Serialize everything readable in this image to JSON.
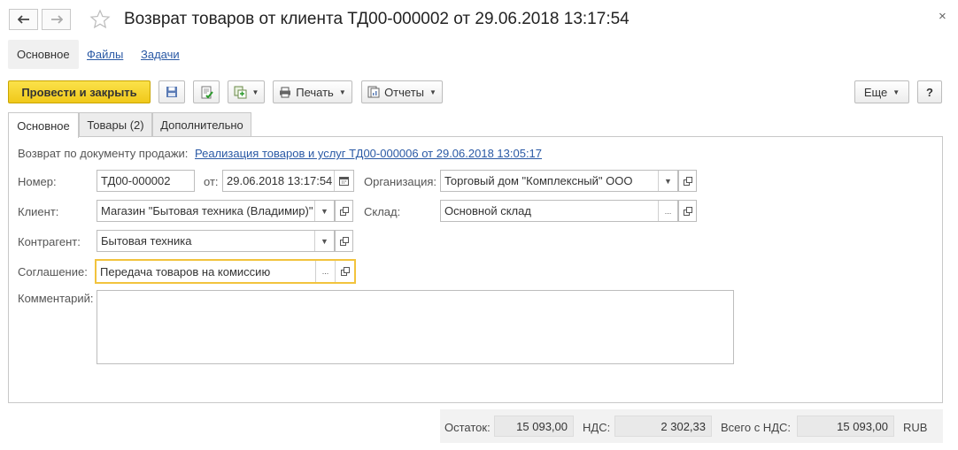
{
  "window": {
    "title": "Возврат товаров от клиента ТД00-000002 от 29.06.2018 13:17:54",
    "close_glyph": "×"
  },
  "sections": [
    "Основное",
    "Файлы",
    "Задачи"
  ],
  "toolbar": {
    "post_and_close": "Провести и закрыть",
    "print": "Печать",
    "reports": "Отчеты",
    "more": "Еще",
    "help": "?"
  },
  "tabs": [
    "Основное",
    "Товары (2)",
    "Дополнительно"
  ],
  "form": {
    "base_doc_label": "Возврат по документу продажи:",
    "base_doc_link": "Реализация товаров и услуг ТД00-000006 от 29.06.2018 13:05:17",
    "number_label": "Номер:",
    "number_value": "ТД00-000002",
    "date_label": "от:",
    "date_value": "29.06.2018 13:17:54",
    "org_label": "Организация:",
    "org_value": "Торговый дом \"Комплексный\" ООО",
    "client_label": "Клиент:",
    "client_value": "Магазин \"Бытовая техника (Владимир)\"",
    "warehouse_label": "Склад:",
    "warehouse_value": "Основной склад",
    "counterparty_label": "Контрагент:",
    "counterparty_value": "Бытовая техника",
    "agreement_label": "Соглашение:",
    "agreement_value": "Передача товаров на комиссию",
    "comment_label": "Комментарий:",
    "comment_value": ""
  },
  "footer": {
    "balance_label": "Остаток:",
    "balance_value": "15 093,00",
    "vat_label": "НДС:",
    "vat_value": "2 302,33",
    "total_label": "Всего с НДС:",
    "total_value": "15 093,00",
    "currency": "RUB"
  },
  "icons": {
    "back": "back-arrow-icon",
    "forward": "forward-arrow-icon",
    "favorite": "star-icon",
    "save": "floppy-disk-icon",
    "post": "post-document-icon",
    "create_based": "create-based-on-icon",
    "print": "printer-icon",
    "reports": "reports-icon",
    "calendar": "calendar-icon",
    "open": "open-form-icon",
    "dropdown": "triangle-down-icon",
    "select": "ellipsis-icon"
  },
  "colors": {
    "primary_button": "#f5d12a",
    "link": "#2a59a5",
    "focus_border": "#f2c33d"
  }
}
